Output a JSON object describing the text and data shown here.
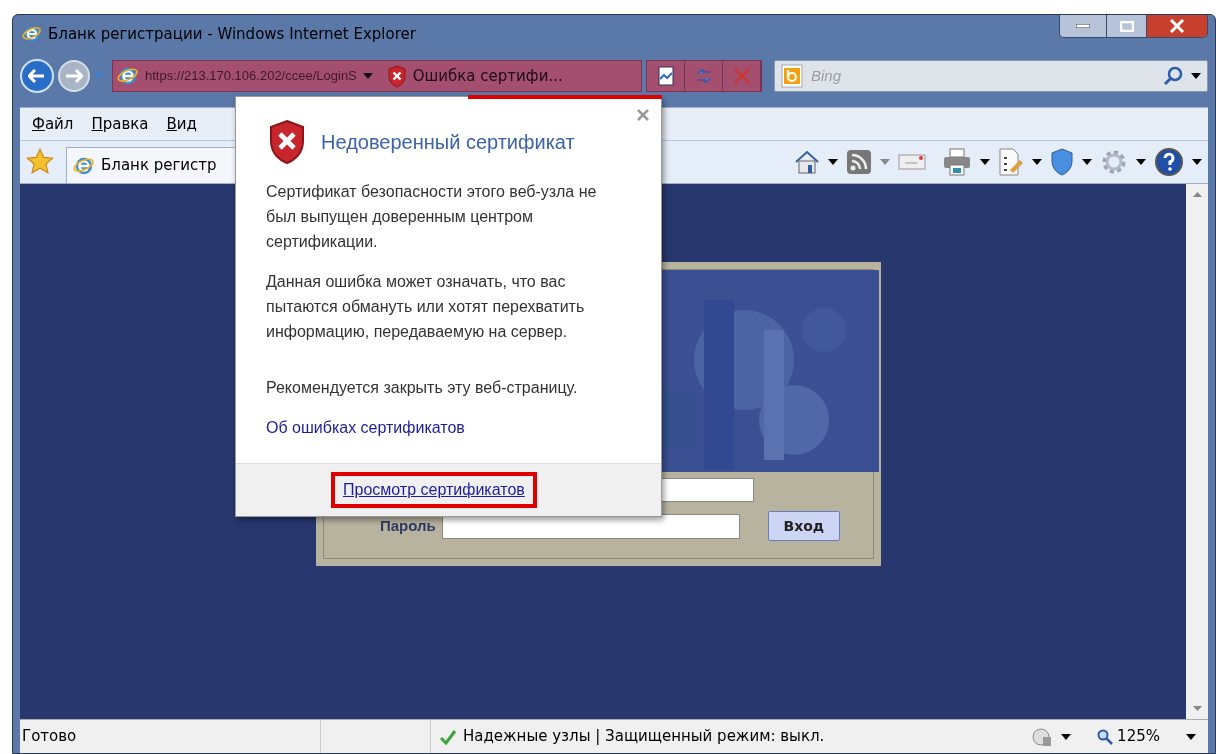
{
  "window": {
    "title": "Бланк регистрации - Windows Internet Explorer"
  },
  "address_bar": {
    "url": "https://213.170.106.202/ccee/LoginS",
    "cert_error": "Ошибка сертифи..."
  },
  "search": {
    "placeholder": "Bing"
  },
  "menu": [
    {
      "label": "Файл"
    },
    {
      "label": "Правка"
    },
    {
      "label": "Вид"
    }
  ],
  "tab": {
    "title": "Бланк регистр"
  },
  "login_form": {
    "password_label": "Пароль",
    "submit": "Вход"
  },
  "popup": {
    "title": "Недоверенный сертификат",
    "paragraphs": [
      "Сертификат безопасности этого веб-узла не был выпущен доверенным центром сертификации.",
      "Данная ошибка может означать, что вас пытаются обмануть или хотят перехватить информацию, передаваемую на сервер.",
      "Рекомендуется закрыть эту веб-страницу."
    ],
    "link": "Об ошибках сертификатов",
    "footer_link": "Просмотр сертификатов"
  },
  "status_bar": {
    "status": "Готово",
    "zone": "Надежные узлы | Защищенный режим: выкл.",
    "zoom": "125%"
  }
}
